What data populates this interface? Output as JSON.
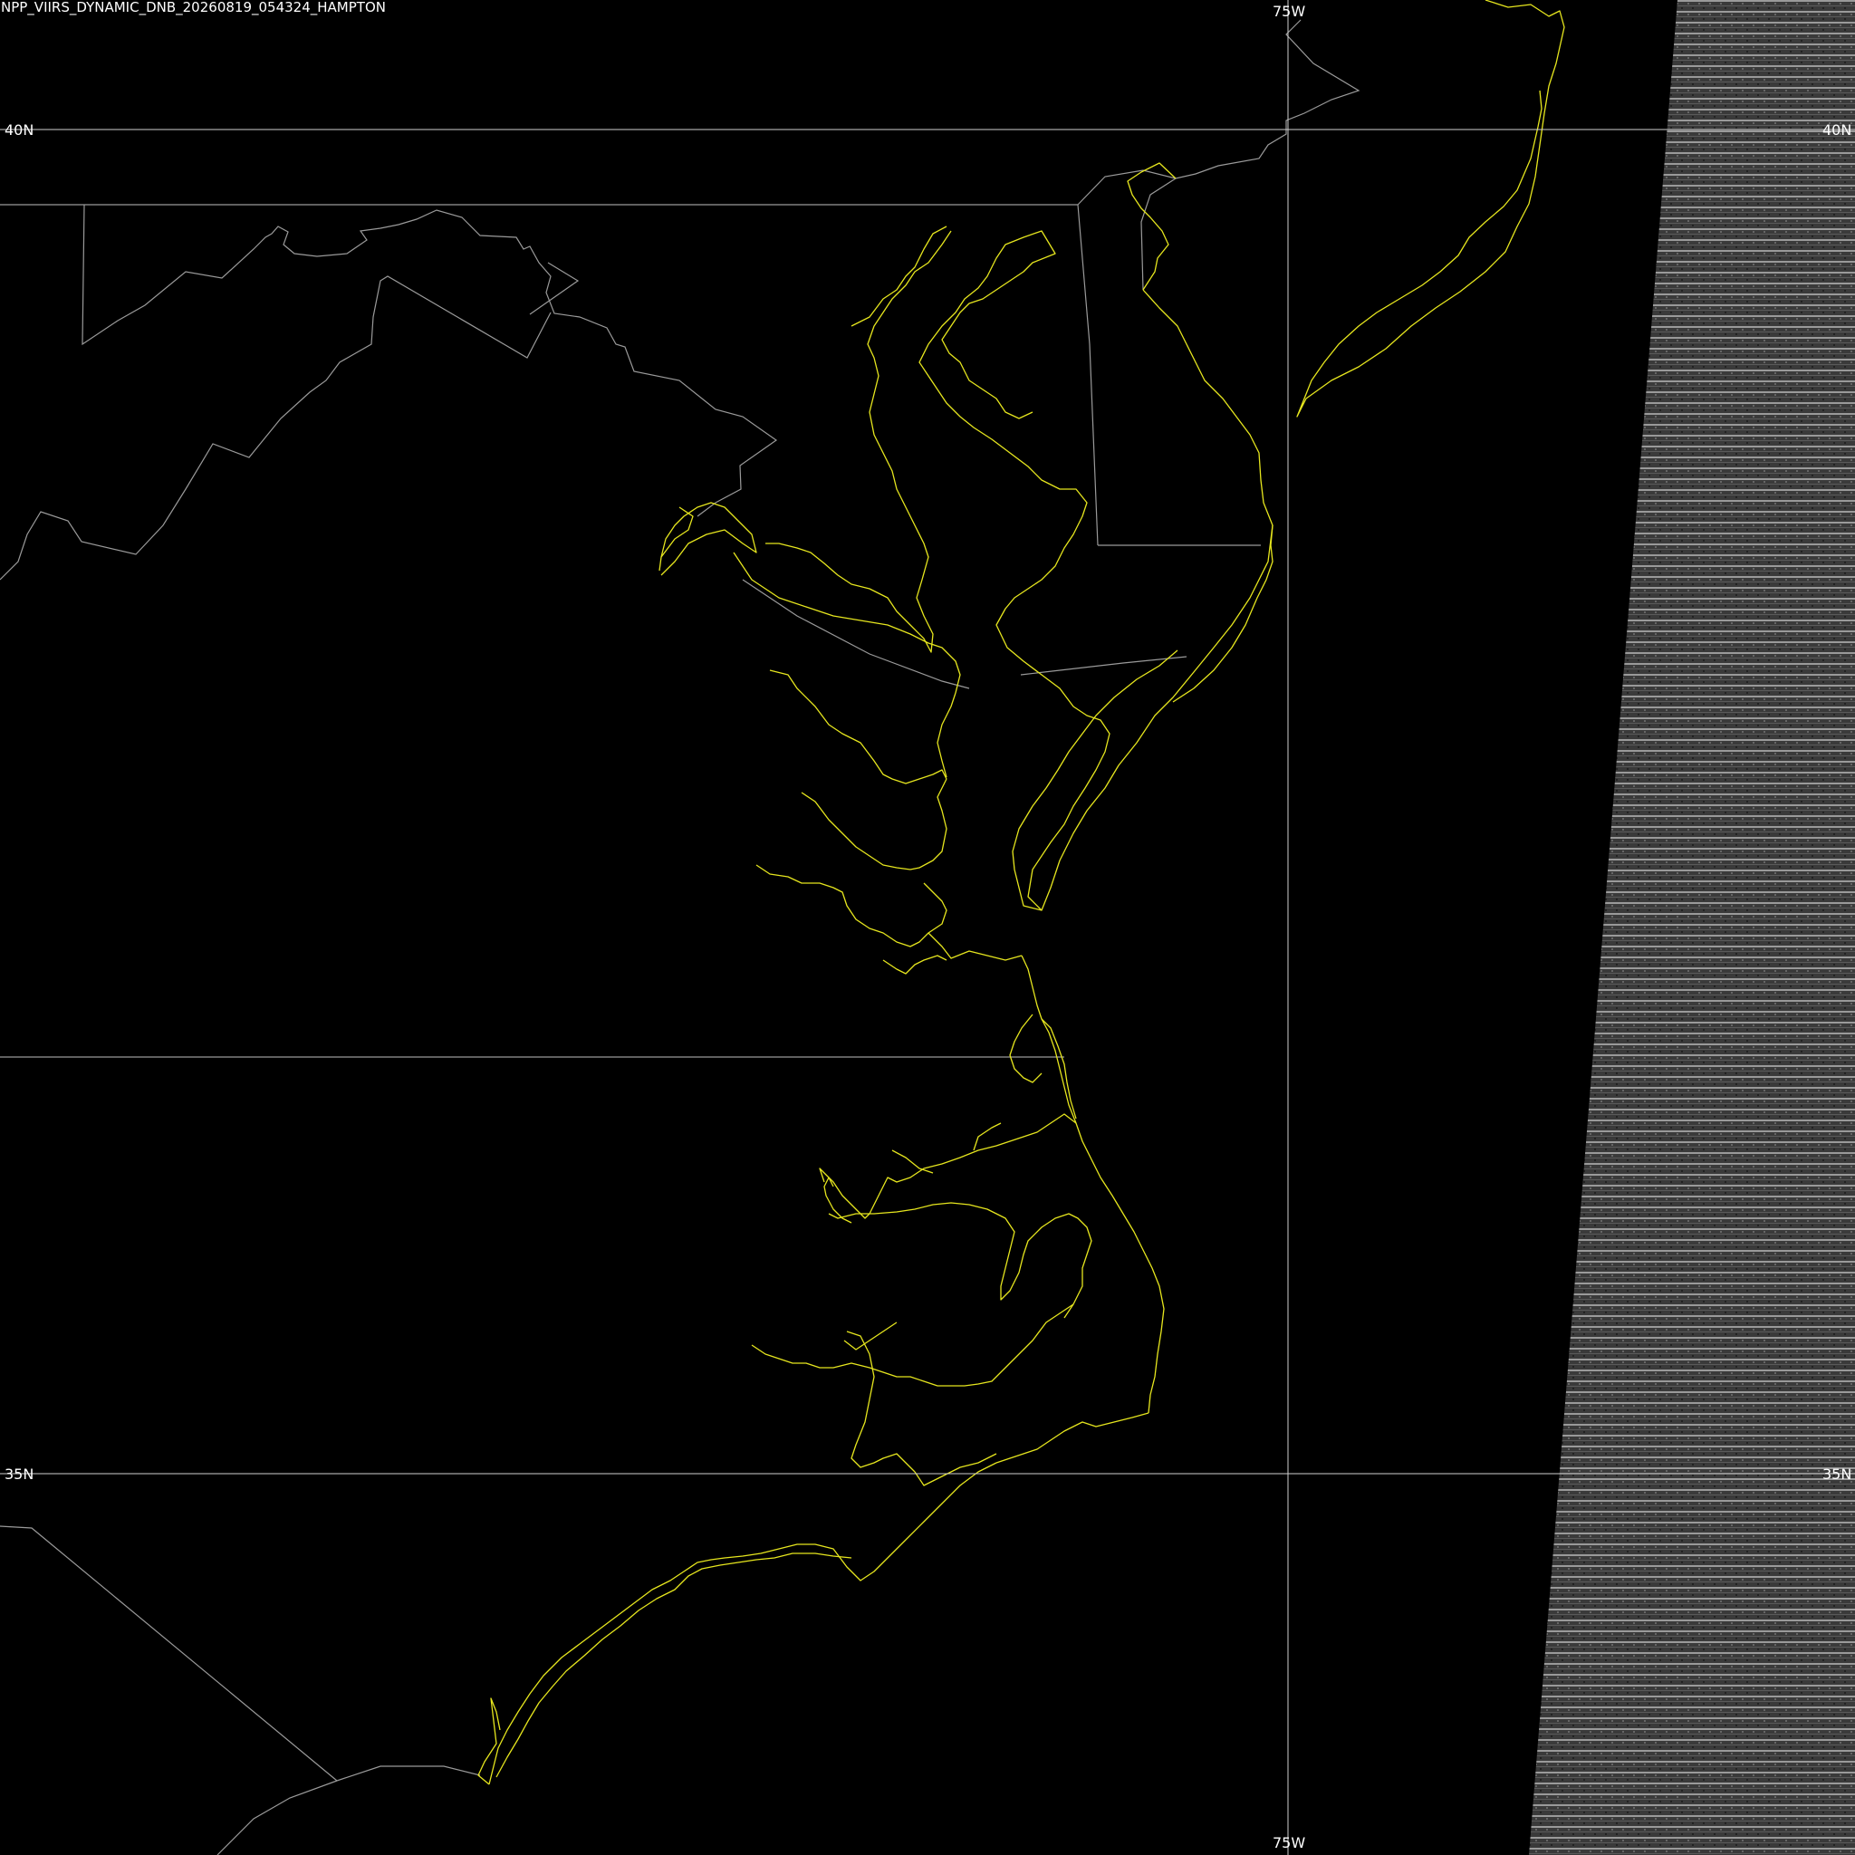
{
  "image_title": "NPP_VIIRS_DYNAMIC_DNB_20260819_054324_HAMPTON",
  "graticule": {
    "lat_40_left": "40N",
    "lat_40_right": "40N",
    "lat_35_left": "35N",
    "lat_35_right": "35N",
    "lon_75_top": "75W",
    "lon_75_bottom": "75W"
  },
  "colors": {
    "background": "#000000",
    "coastline": "#e6e61e",
    "borders": "#9a9a9a",
    "graticule": "#d0d0d0",
    "labels": "#ffffff"
  }
}
